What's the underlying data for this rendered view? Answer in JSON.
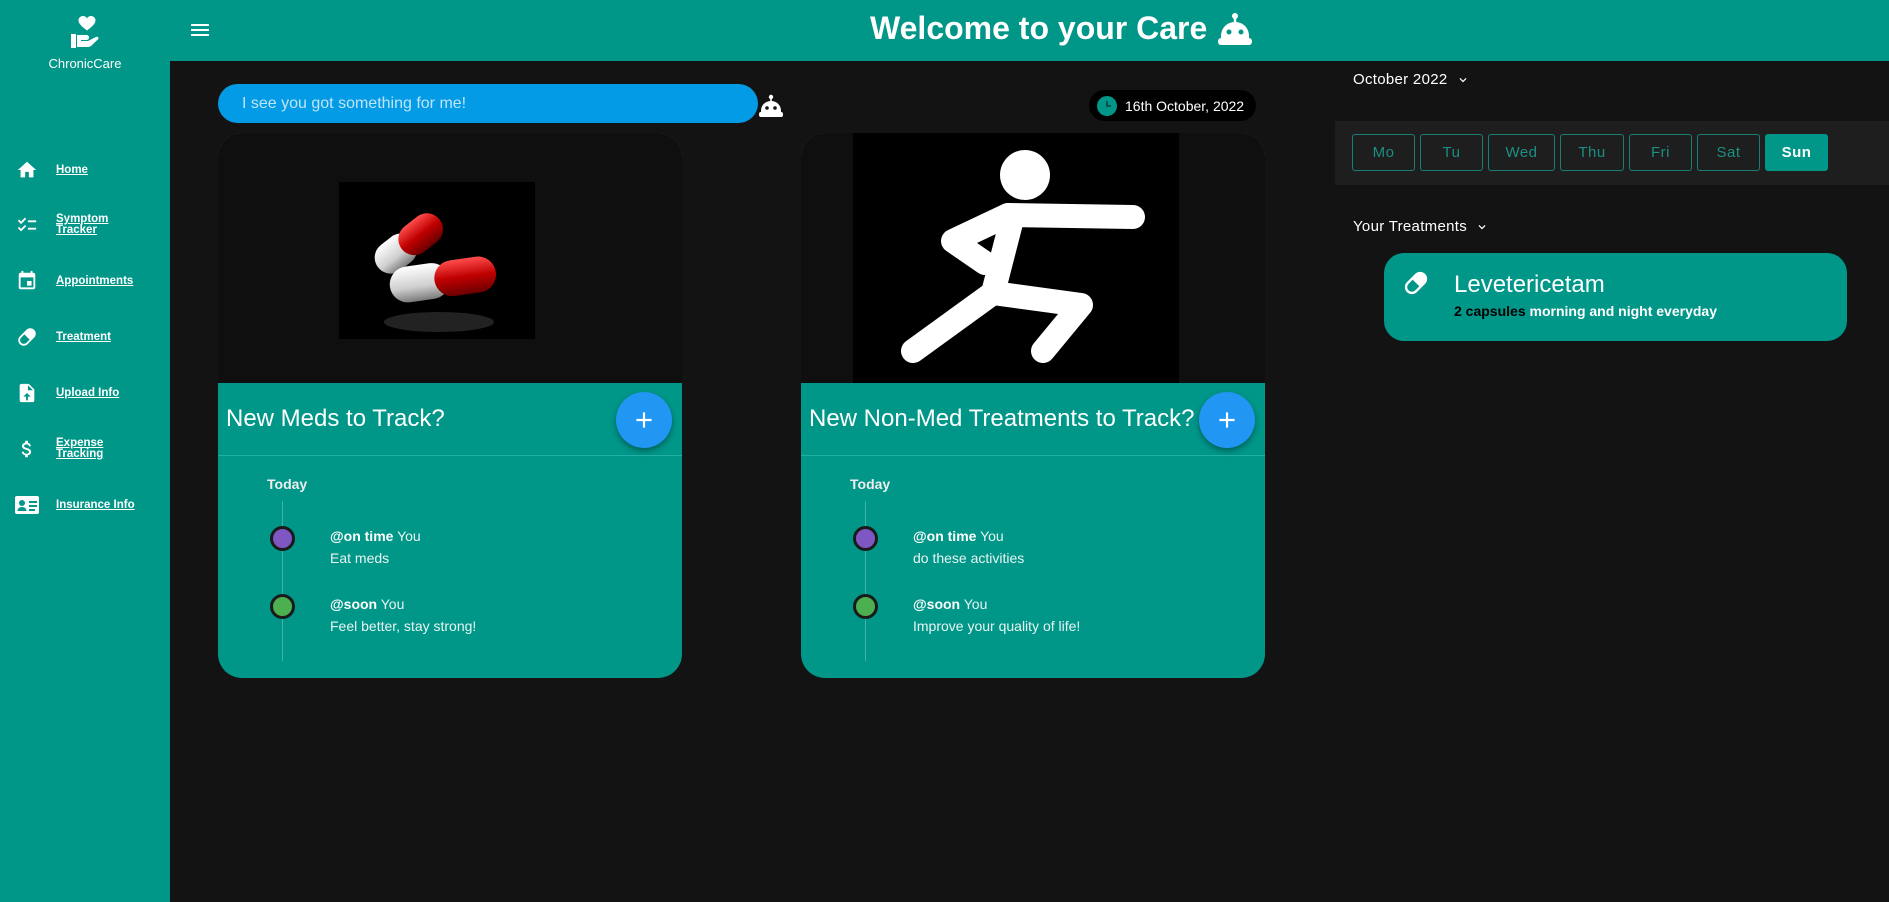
{
  "app": {
    "name": "ChronicCare"
  },
  "header": {
    "title": "Welcome to your Care"
  },
  "sidebar": {
    "items": [
      {
        "label": "Home",
        "icon": "home-icon"
      },
      {
        "label": "Symptom Tracker",
        "icon": "checklist-icon"
      },
      {
        "label": "Appointments",
        "icon": "calendar-icon"
      },
      {
        "label": "Treatment",
        "icon": "pill-icon"
      },
      {
        "label": "Upload Info",
        "icon": "file-upload-icon"
      },
      {
        "label": "Expense Tracking",
        "icon": "dollar-icon"
      },
      {
        "label": "Insurance Info",
        "icon": "id-card-icon"
      }
    ]
  },
  "chat": {
    "placeholder": "I see you got something for me!"
  },
  "date_badge": "16th October, 2022",
  "cards": [
    {
      "title": "New Meds to Track?",
      "today": "Today",
      "timeline": [
        {
          "tag": "@on time",
          "who": "You",
          "text": "Eat meds",
          "color": "#7e57c2"
        },
        {
          "tag": "@soon",
          "who": "You",
          "text": "Feel better, stay strong!",
          "color": "#4caf50"
        }
      ]
    },
    {
      "title": "New Non-Med Treatments to Track?",
      "today": "Today",
      "timeline": [
        {
          "tag": "@on time",
          "who": "You",
          "text": "do these activities",
          "color": "#7e57c2"
        },
        {
          "tag": "@soon",
          "who": "You",
          "text": "Improve your quality of life!",
          "color": "#4caf50"
        }
      ]
    }
  ],
  "calendar": {
    "month": "October 2022",
    "days": [
      "Mo",
      "Tu",
      "Wed",
      "Thu",
      "Fri",
      "Sat",
      "Sun"
    ],
    "active_day": "Sun"
  },
  "treatments": {
    "heading": "Your Treatments",
    "items": [
      {
        "name": "Levetericetam",
        "dose": "2 capsules",
        "schedule": "morning and night everyday"
      }
    ]
  },
  "colors": {
    "primary": "#009688",
    "accent": "#2196f3",
    "chat": "#039be5",
    "background": "#131313"
  }
}
